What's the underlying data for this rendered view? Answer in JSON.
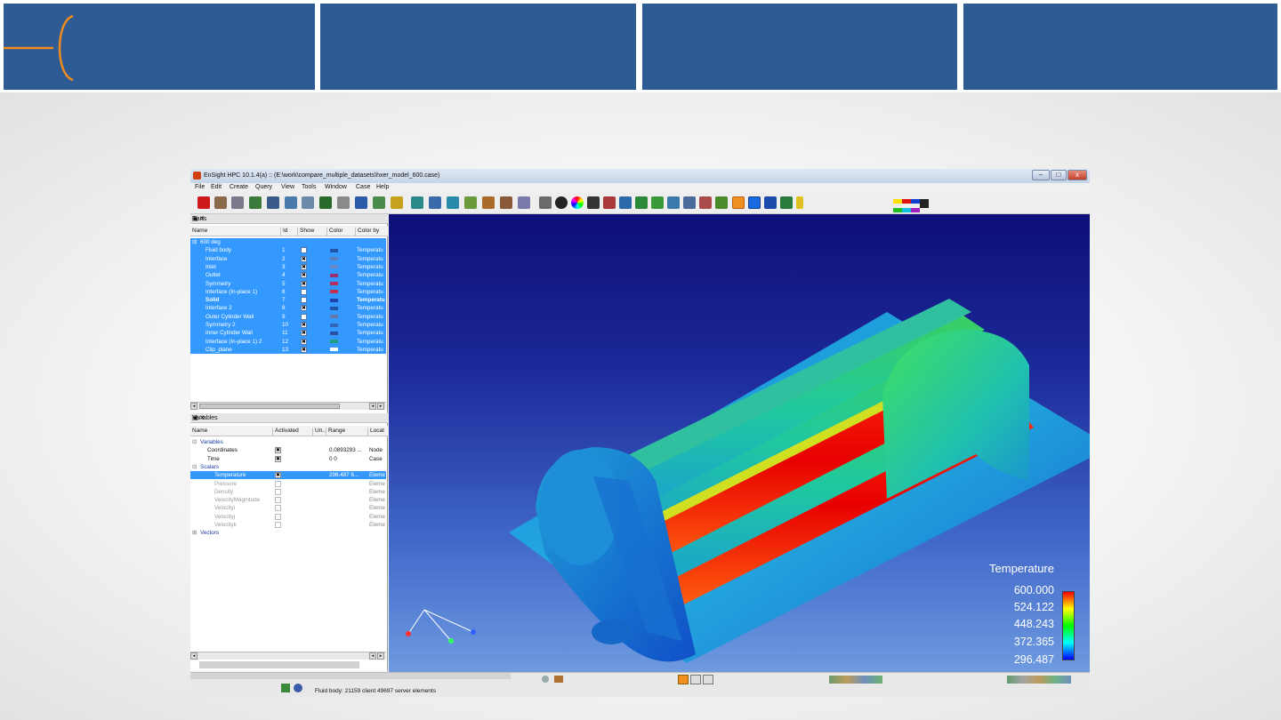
{
  "app": {
    "title": "EnSight HPC 10.1.4(a) :: (E:\\work\\compare_multiple_datasets\\hxer_model_600.case)",
    "window_buttons": [
      "–",
      "□",
      "x"
    ]
  },
  "menu": [
    "File",
    "Edit",
    "Create",
    "Query",
    "View",
    "Tools",
    "Window",
    "Case",
    "Help"
  ],
  "parts_panel": {
    "title": "Parts",
    "columns": [
      "Name",
      "Id",
      "Show",
      "Color",
      "Color by"
    ],
    "group": "600 deg",
    "rows": [
      {
        "name": "Fluid body",
        "id": "1",
        "show": "",
        "color": "#2255aa",
        "color_by": "Temperatu"
      },
      {
        "name": "Interface",
        "id": "2",
        "show": "✖",
        "color": "#5a7fc0",
        "color_by": "Temperatu"
      },
      {
        "name": "Inlet",
        "id": "3",
        "show": "✖",
        "color": "#6a8ac8",
        "color_by": "Temperatu"
      },
      {
        "name": "Outlet",
        "id": "4",
        "show": "✖",
        "color": "#9a3070",
        "color_by": "Temperatu"
      },
      {
        "name": "Symmetry",
        "id": "5",
        "show": "✖",
        "color": "#b03060",
        "color_by": "Temperatu"
      },
      {
        "name": "Interface (In-place 1)",
        "id": "6",
        "show": "",
        "color": "#c03050",
        "color_by": "Temperatu"
      },
      {
        "name": "Solid",
        "id": "7",
        "show": "",
        "color": "#2244aa",
        "color_by": "Temperatu"
      },
      {
        "name": "Interface 2",
        "id": "8",
        "show": "✖",
        "color": "#2255aa",
        "color_by": "Temperatu"
      },
      {
        "name": "Outer Cylinder Wall",
        "id": "9",
        "show": "",
        "color": "#6677aa",
        "color_by": "Temperatu"
      },
      {
        "name": "Symmetry 2",
        "id": "10",
        "show": "✖",
        "color": "#3366bb",
        "color_by": "Temperatu"
      },
      {
        "name": "Inner Cylinder Wall",
        "id": "11",
        "show": "✖",
        "color": "#2a4fa0",
        "color_by": "Temperatu"
      },
      {
        "name": "Interface (In-place 1) 2",
        "id": "12",
        "show": "✖",
        "color": "#20a080",
        "color_by": "Temperatu"
      },
      {
        "name": "Clip_plane",
        "id": "13",
        "show": "✖",
        "color": "#ffffff",
        "color_by": "Temperatu"
      }
    ]
  },
  "variables_panel": {
    "title": "Variables",
    "columns": [
      "Name",
      "Activated",
      "Un..",
      "Range",
      "Locat"
    ],
    "rows": [
      {
        "name": "Variables",
        "indent": 0,
        "activated": "",
        "range": "",
        "loc": "",
        "kind": "group"
      },
      {
        "name": "Coordinates",
        "indent": 1,
        "activated": "✖",
        "range": "0.0893293 ...",
        "loc": "Node",
        "kind": "normal"
      },
      {
        "name": "Time",
        "indent": 1,
        "activated": "✖",
        "range": "0   0",
        "loc": "Case",
        "kind": "normal"
      },
      {
        "name": "Scalars",
        "indent": 0,
        "activated": "",
        "range": "",
        "loc": "",
        "kind": "group"
      },
      {
        "name": "Temperature",
        "indent": 2,
        "activated": "✖",
        "range": "296.487   6...",
        "loc": "Eleme",
        "kind": "selected"
      },
      {
        "name": "Pressure",
        "indent": 2,
        "activated": "",
        "range": "",
        "loc": "Eleme",
        "kind": "dim"
      },
      {
        "name": "Density",
        "indent": 2,
        "activated": "",
        "range": "",
        "loc": "Eleme",
        "kind": "dim"
      },
      {
        "name": "VelocityMagnitude",
        "indent": 2,
        "activated": "",
        "range": "",
        "loc": "Eleme",
        "kind": "dim"
      },
      {
        "name": "Velocityi",
        "indent": 2,
        "activated": "",
        "range": "",
        "loc": "Eleme",
        "kind": "dim"
      },
      {
        "name": "Velocityj",
        "indent": 2,
        "activated": "",
        "range": "",
        "loc": "Eleme",
        "kind": "dim"
      },
      {
        "name": "Velocityk",
        "indent": 2,
        "activated": "",
        "range": "",
        "loc": "Eleme",
        "kind": "dim"
      },
      {
        "name": "Vectors",
        "indent": 0,
        "activated": "",
        "range": "",
        "loc": "",
        "kind": "group"
      }
    ]
  },
  "legend": {
    "title": "Temperature",
    "values": [
      "600.000",
      "524.122",
      "448.243",
      "372.365",
      "296.487"
    ]
  },
  "status": {
    "text": "Fluid body: 21159 client 49697 server elements"
  },
  "colors": {
    "header_blue": "#2f5b94",
    "accent_orange": "#ee8a1e",
    "selection_blue": "#3399ff"
  },
  "icons": [
    "ensight-app-icon",
    "triad-axes-icon",
    "palette-icon"
  ]
}
